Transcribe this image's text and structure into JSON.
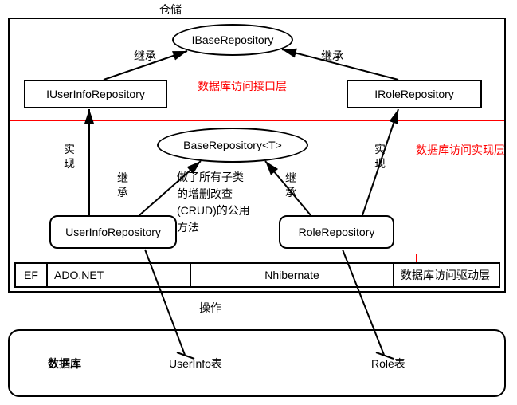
{
  "title": "仓储",
  "interface_layer": {
    "label": "数据库访问接口层",
    "nodes": {
      "ibase": "IBaseRepository",
      "iuser": "IUserInfoRepository",
      "irole": "IRoleRepository"
    },
    "edges": {
      "inherit_left": "继承",
      "inherit_right": "继承"
    }
  },
  "impl_layer": {
    "label": "数据库访问实现层",
    "nodes": {
      "base": "BaseRepository<T>",
      "user": "UserInfoRepository",
      "role": "RoleRepository"
    },
    "edges": {
      "impl_left": "实\n现",
      "impl_right": "实\n现",
      "inherit_left": "继\n承",
      "inherit_right": "继\n承"
    },
    "note": "做了所有子类\n的增删改查\n(CRUD)的公用\n方法"
  },
  "driver_layer": {
    "label": "数据库访问驱动层",
    "items": [
      "EF",
      "ADO.NET",
      "Nhibernate"
    ]
  },
  "db": {
    "label": "数据库",
    "tables": {
      "user": "UserInfo表",
      "role": "Role表"
    },
    "op": "操作"
  }
}
